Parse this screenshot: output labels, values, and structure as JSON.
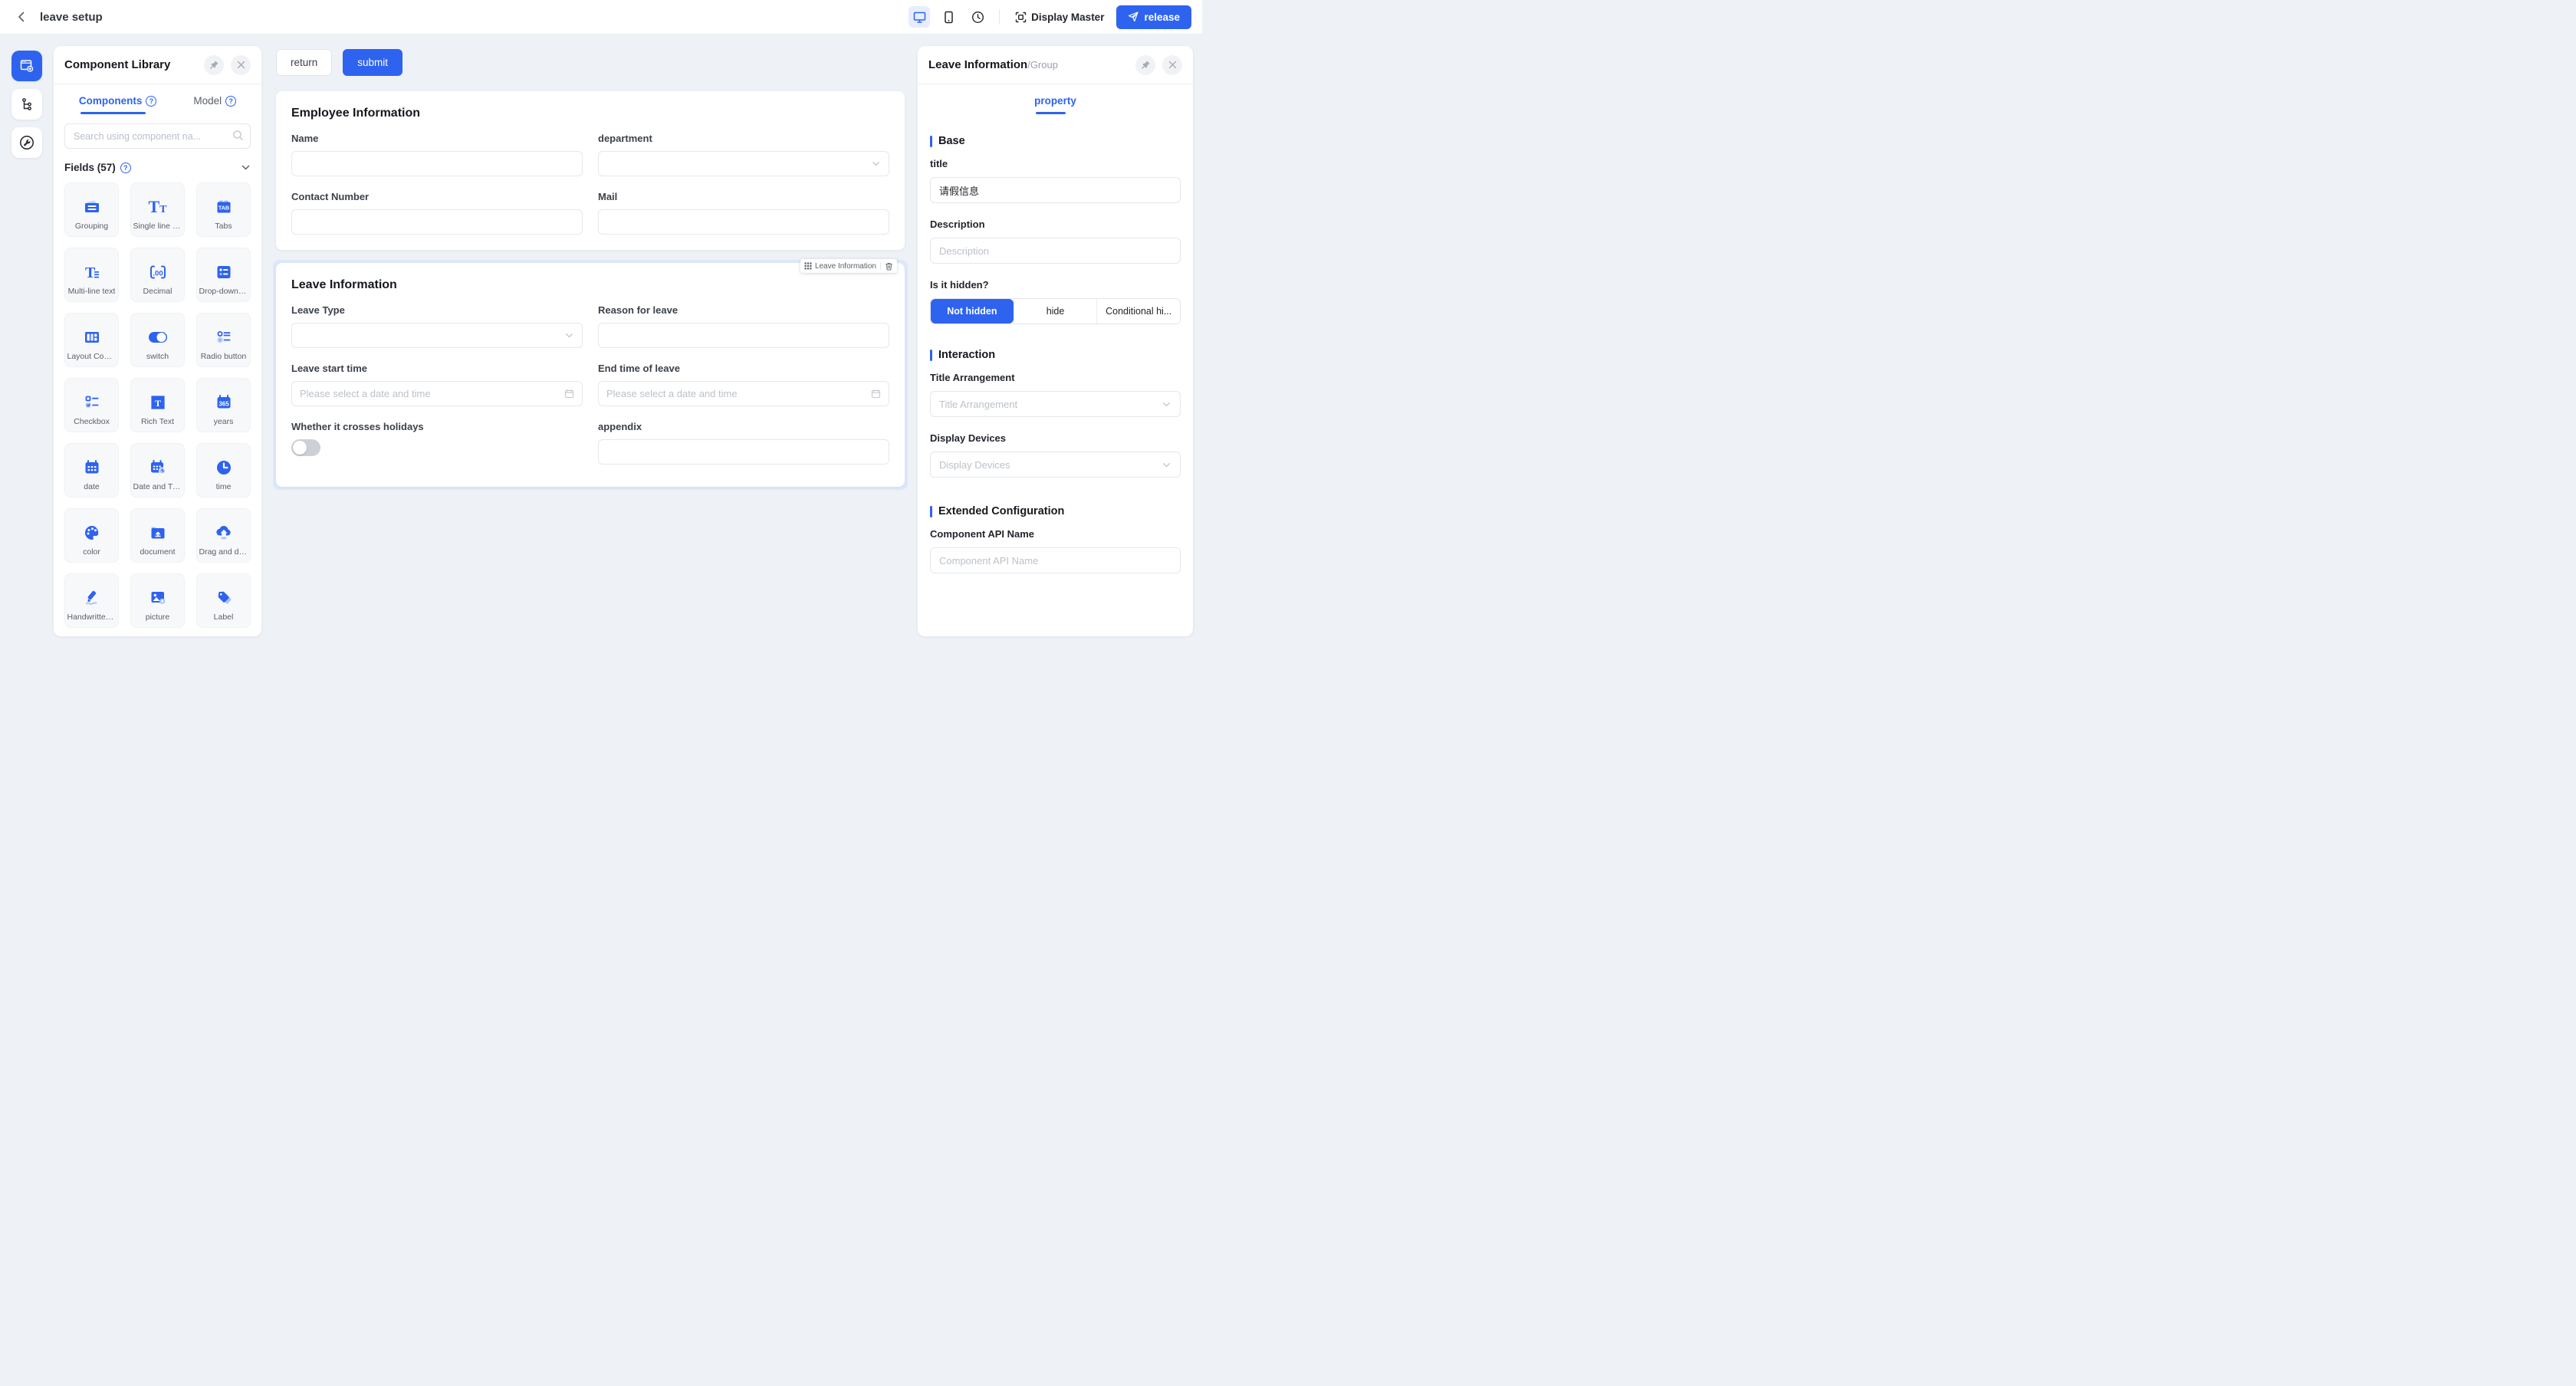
{
  "colors": {
    "accent": "#2e63f0",
    "page_bg": "#eef1f6",
    "selection_bg": "#dfe7fb",
    "canvas_card_bg": "#ffffff"
  },
  "top_bar": {
    "title": "leave setup",
    "display_master_label": "Display Master",
    "release_label": "release",
    "device_icons": [
      "desktop-icon",
      "mobile-icon",
      "history-icon"
    ]
  },
  "left_panel": {
    "title": "Component Library",
    "tabs": [
      {
        "label": "Components"
      },
      {
        "label": "Model"
      }
    ],
    "search_placeholder": "Search using component na...",
    "fields_header": "Fields (57)",
    "components": [
      {
        "label": "Grouping",
        "icon": "grouping-icon"
      },
      {
        "label": "Single line text",
        "icon": "single-line-text-icon"
      },
      {
        "label": "Tabs",
        "icon": "tabs-icon"
      },
      {
        "label": "Multi-line text",
        "icon": "multi-line-text-icon"
      },
      {
        "label": "Decimal",
        "icon": "decimal-icon"
      },
      {
        "label": "Drop-down ra...",
        "icon": "drop-down-icon"
      },
      {
        "label": "Layout Contai...",
        "icon": "layout-container-icon"
      },
      {
        "label": "switch",
        "icon": "switch-icon"
      },
      {
        "label": "Radio button",
        "icon": "radio-button-icon"
      },
      {
        "label": "Checkbox",
        "icon": "checkbox-icon"
      },
      {
        "label": "Rich Text",
        "icon": "rich-text-icon"
      },
      {
        "label": "years",
        "icon": "years-icon"
      },
      {
        "label": "date",
        "icon": "date-icon"
      },
      {
        "label": "Date and Time",
        "icon": "date-and-time-icon"
      },
      {
        "label": "time",
        "icon": "time-icon"
      },
      {
        "label": "color",
        "icon": "color-icon"
      },
      {
        "label": "document",
        "icon": "document-icon"
      },
      {
        "label": "Drag and drop...",
        "icon": "drag-and-drop-upload-icon"
      },
      {
        "label": "Handwritten si...",
        "icon": "handwritten-signature-icon"
      },
      {
        "label": "picture",
        "icon": "picture-icon"
      },
      {
        "label": "Label",
        "icon": "label-icon"
      }
    ]
  },
  "canvas": {
    "return_label": "return",
    "submit_label": "submit",
    "employee": {
      "title": "Employee Information",
      "fields": [
        {
          "label": "Name",
          "type": "text"
        },
        {
          "label": "department",
          "type": "select"
        },
        {
          "label": "Contact Number",
          "type": "text"
        },
        {
          "label": "Mail",
          "type": "text"
        }
      ]
    },
    "leave": {
      "title": "Leave Information",
      "selected_tag": "Leave Information",
      "fields": [
        {
          "label": "Leave Type",
          "type": "select"
        },
        {
          "label": "Reason for leave",
          "type": "text"
        },
        {
          "label": "Leave start time",
          "type": "date",
          "placeholder": "Please select a date and time"
        },
        {
          "label": "End time of leave",
          "type": "date",
          "placeholder": "Please select a date and time"
        },
        {
          "label": "Whether it crosses holidays",
          "type": "switch",
          "value": "off"
        },
        {
          "label": "appendix",
          "type": "text"
        }
      ]
    }
  },
  "right_panel": {
    "title": "Leave Information",
    "subtitle": "/Group",
    "tab": "property",
    "base": {
      "label": "Base",
      "title_label": "title",
      "title_value": "请假信息",
      "description_label": "Description",
      "description_placeholder": "Description",
      "hidden_label": "Is it hidden?",
      "hidden_options": [
        "Not hidden",
        "hide",
        "Conditional hi..."
      ],
      "hidden_selected": "Not hidden"
    },
    "interaction": {
      "label": "Interaction",
      "title_arrangement_label": "Title Arrangement",
      "title_arrangement_placeholder": "Title Arrangement",
      "display_devices_label": "Display Devices",
      "display_devices_placeholder": "Display Devices"
    },
    "extended": {
      "label": "Extended Configuration",
      "api_name_label": "Component API Name",
      "api_name_placeholder": "Component API Name"
    }
  }
}
